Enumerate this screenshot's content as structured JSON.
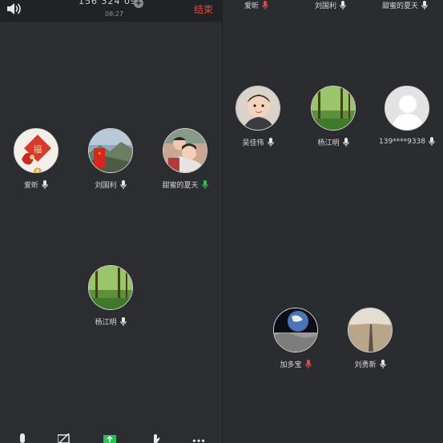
{
  "call": {
    "number": "156 324 091",
    "add_label": "+",
    "elapsed": "08:27",
    "end_label": "结束"
  },
  "left_members": [
    {
      "name": "爱昕",
      "mic": "white",
      "host_badge": true
    },
    {
      "name": "刘国利",
      "mic": "white"
    },
    {
      "name": "甜蜜的夏天",
      "mic": "green"
    },
    {
      "name": "杨江明",
      "mic": "white"
    }
  ],
  "right_top_members": [
    {
      "name": "爱昕",
      "mic": "red"
    },
    {
      "name": "刘国利",
      "mic": "white"
    },
    {
      "name": "甜蜜的夏天",
      "mic": "white"
    }
  ],
  "right_members": [
    {
      "name": "吴佳伟",
      "mic": "white"
    },
    {
      "name": "杨江明",
      "mic": "white"
    },
    {
      "name": "139****9338",
      "mic": "white"
    },
    {
      "name": "加多宝",
      "mic": "red"
    },
    {
      "name": "刘勇新",
      "mic": "white"
    }
  ],
  "toolbar": [
    "mic-icon",
    "camera-off-icon",
    "share-icon",
    "hand-raise-icon",
    "more-icon"
  ],
  "colors": {
    "background": "#2b2d30",
    "end_red": "#e04b3f",
    "mic_green": "#2bbf5a",
    "mic_red": "#e04b4b",
    "host_badge": "#e8a23a"
  }
}
